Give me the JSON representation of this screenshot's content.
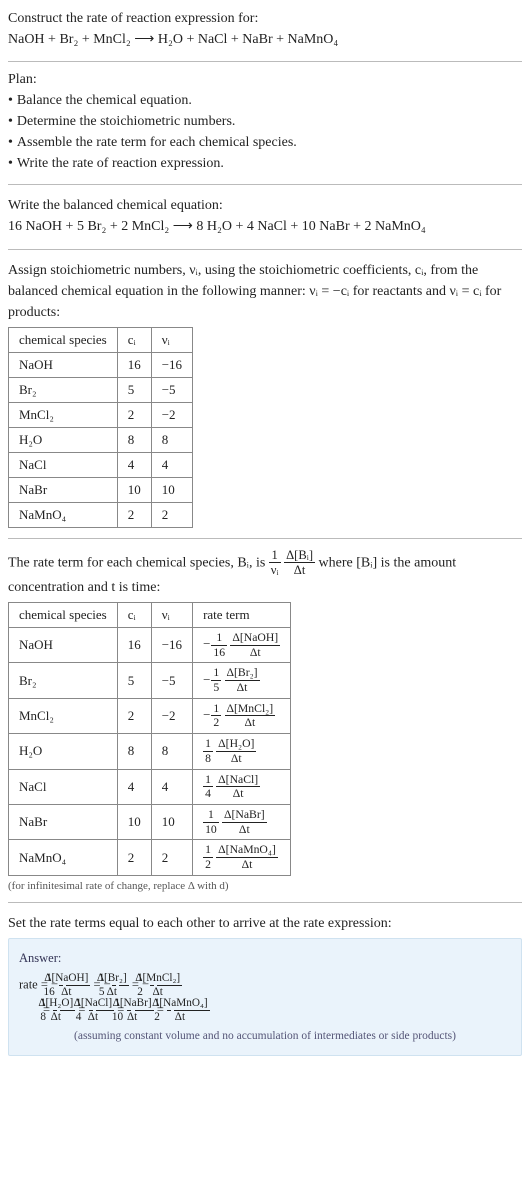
{
  "prompt": {
    "line1": "Construct the rate of reaction expression for:",
    "equation": "NaOH + Br₂ + MnCl₂  ⟶  H₂O + NaCl + NaBr + NaMnO₄"
  },
  "plan": {
    "heading": "Plan:",
    "items": [
      "Balance the chemical equation.",
      "Determine the stoichiometric numbers.",
      "Assemble the rate term for each chemical species.",
      "Write the rate of reaction expression."
    ]
  },
  "balanced": {
    "intro": "Write the balanced chemical equation:",
    "equation": "16 NaOH + 5 Br₂ + 2 MnCl₂  ⟶  8 H₂O + 4 NaCl + 10 NaBr + 2 NaMnO₄"
  },
  "stoich": {
    "intro": "Assign stoichiometric numbers, νᵢ, using the stoichiometric coefficients, cᵢ, from the balanced chemical equation in the following manner: νᵢ = −cᵢ for reactants and νᵢ = cᵢ for products:",
    "headers": {
      "species": "chemical species",
      "ci": "cᵢ",
      "vi": "νᵢ"
    },
    "rows": [
      {
        "species": "NaOH",
        "ci": "16",
        "vi": "−16"
      },
      {
        "species": "Br₂",
        "ci": "5",
        "vi": "−5"
      },
      {
        "species": "MnCl₂",
        "ci": "2",
        "vi": "−2"
      },
      {
        "species": "H₂O",
        "ci": "8",
        "vi": "8"
      },
      {
        "species": "NaCl",
        "ci": "4",
        "vi": "4"
      },
      {
        "species": "NaBr",
        "ci": "10",
        "vi": "10"
      },
      {
        "species": "NaMnO₄",
        "ci": "2",
        "vi": "2"
      }
    ]
  },
  "rateterms": {
    "intro1": "The rate term for each chemical species, Bᵢ, is ",
    "intro2": " where [Bᵢ] is the amount concentration and t is time:",
    "frac": {
      "num1": "1",
      "den1": "νᵢ",
      "num2": "Δ[Bᵢ]",
      "den2": "Δt"
    },
    "headers": {
      "species": "chemical species",
      "ci": "cᵢ",
      "vi": "νᵢ",
      "rate": "rate term"
    },
    "rows": [
      {
        "species": "NaOH",
        "ci": "16",
        "vi": "−16",
        "sign": "−",
        "coef_num": "1",
        "coef_den": "16",
        "dnum": "Δ[NaOH]",
        "dden": "Δt"
      },
      {
        "species": "Br₂",
        "ci": "5",
        "vi": "−5",
        "sign": "−",
        "coef_num": "1",
        "coef_den": "5",
        "dnum": "Δ[Br₂]",
        "dden": "Δt"
      },
      {
        "species": "MnCl₂",
        "ci": "2",
        "vi": "−2",
        "sign": "−",
        "coef_num": "1",
        "coef_den": "2",
        "dnum": "Δ[MnCl₂]",
        "dden": "Δt"
      },
      {
        "species": "H₂O",
        "ci": "8",
        "vi": "8",
        "sign": "",
        "coef_num": "1",
        "coef_den": "8",
        "dnum": "Δ[H₂O]",
        "dden": "Δt"
      },
      {
        "species": "NaCl",
        "ci": "4",
        "vi": "4",
        "sign": "",
        "coef_num": "1",
        "coef_den": "4",
        "dnum": "Δ[NaCl]",
        "dden": "Δt"
      },
      {
        "species": "NaBr",
        "ci": "10",
        "vi": "10",
        "sign": "",
        "coef_num": "1",
        "coef_den": "10",
        "dnum": "Δ[NaBr]",
        "dden": "Δt"
      },
      {
        "species": "NaMnO₄",
        "ci": "2",
        "vi": "2",
        "sign": "",
        "coef_num": "1",
        "coef_den": "2",
        "dnum": "Δ[NaMnO₄]",
        "dden": "Δt"
      }
    ],
    "note": "(for infinitesimal rate of change, replace Δ with d)"
  },
  "final": {
    "intro": "Set the rate terms equal to each other to arrive at the rate expression:",
    "label": "Answer:",
    "terms": [
      {
        "prefix": "rate = ",
        "sign": "−",
        "num": "1",
        "den": "16",
        "dnum": "Δ[NaOH]",
        "dden": "Δt"
      },
      {
        "prefix": " = ",
        "sign": "−",
        "num": "1",
        "den": "5",
        "dnum": "Δ[Br₂]",
        "dden": "Δt"
      },
      {
        "prefix": " = ",
        "sign": "−",
        "num": "1",
        "den": "2",
        "dnum": "Δ[MnCl₂]",
        "dden": "Δt"
      },
      {
        "prefix": " = ",
        "sign": "",
        "num": "1",
        "den": "8",
        "dnum": "Δ[H₂O]",
        "dden": "Δt"
      },
      {
        "prefix": " = ",
        "sign": "",
        "num": "1",
        "den": "4",
        "dnum": "Δ[NaCl]",
        "dden": "Δt"
      },
      {
        "prefix": " = ",
        "sign": "",
        "num": "1",
        "den": "10",
        "dnum": "Δ[NaBr]",
        "dden": "Δt"
      },
      {
        "prefix": " = ",
        "sign": "",
        "num": "1",
        "den": "2",
        "dnum": "Δ[NaMnO₄]",
        "dden": "Δt"
      }
    ],
    "note": "(assuming constant volume and no accumulation of intermediates or side products)"
  }
}
